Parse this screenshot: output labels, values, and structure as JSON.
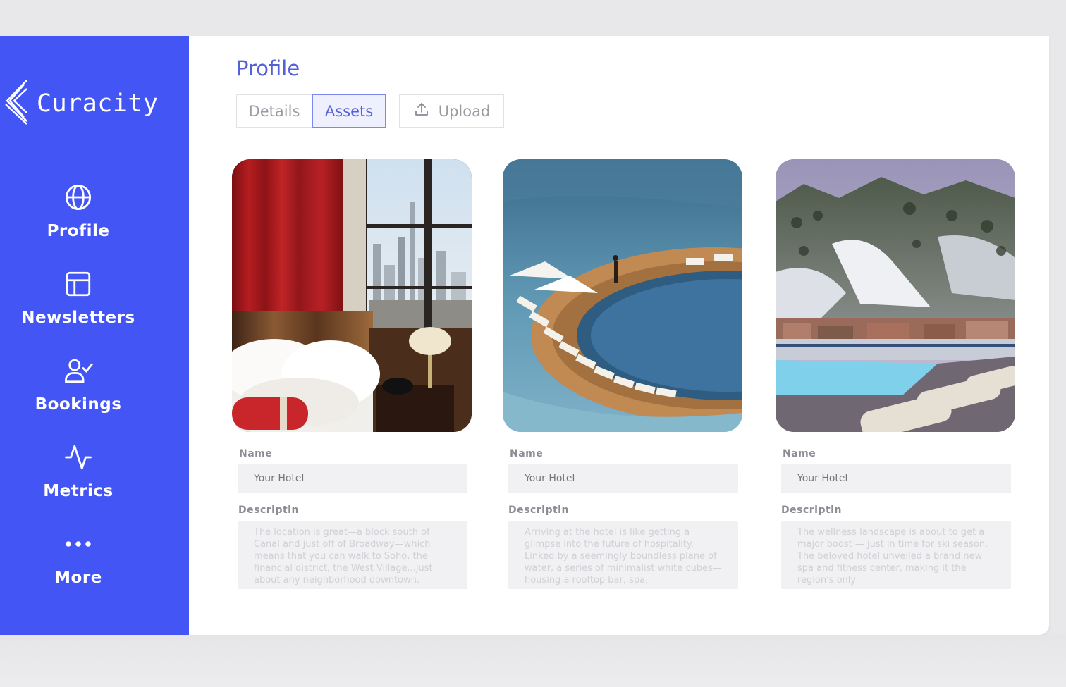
{
  "brand": {
    "name": "Curacity",
    "logo_icon": "chevrons-logo-icon"
  },
  "sidebar": {
    "bg_color": "#4355f5",
    "items": [
      {
        "label": "Profile",
        "icon": "globe-icon"
      },
      {
        "label": "Newsletters",
        "icon": "layout-icon"
      },
      {
        "label": "Bookings",
        "icon": "user-check-icon"
      },
      {
        "label": "Metrics",
        "icon": "activity-icon"
      },
      {
        "label": "More",
        "icon": "more-dots-icon"
      }
    ]
  },
  "page": {
    "title": "Profile",
    "tabs": [
      {
        "label": "Details",
        "active": false
      },
      {
        "label": "Assets",
        "active": true
      }
    ],
    "upload_label": "Upload",
    "upload_icon": "upload-icon"
  },
  "cards": [
    {
      "photo": "hotel-bedroom-photo",
      "name_label": "Name",
      "name_placeholder": "Your Hotel",
      "desc_label": "Descriptin",
      "desc_text": "The location is great—a block south of Canal and just off of Broadway—which means that you can walk to Soho, the financial district, the West Village...just about any neighborhood downtown."
    },
    {
      "photo": "infinity-pool-photo",
      "name_label": "Name",
      "name_placeholder": "Your Hotel",
      "desc_label": "Descriptin",
      "desc_text": "Arriving at the hotel is like getting a glimpse into the future of hospitality. Linked by a seemingly boundless plane of water, a series of minimalist white cubes—housing a rooftop bar, spa,"
    },
    {
      "photo": "snowy-mountain-pool-photo",
      "name_label": "Name",
      "name_placeholder": "Your Hotel",
      "desc_label": "Descriptin",
      "desc_text": "The wellness landscape is about to get a major boost — just in time for ski season. The beloved hotel unveiled a brand new spa and fitness center, making it the region's only"
    }
  ],
  "colors": {
    "accent": "#5360d8",
    "sidebar": "#4355f5"
  }
}
